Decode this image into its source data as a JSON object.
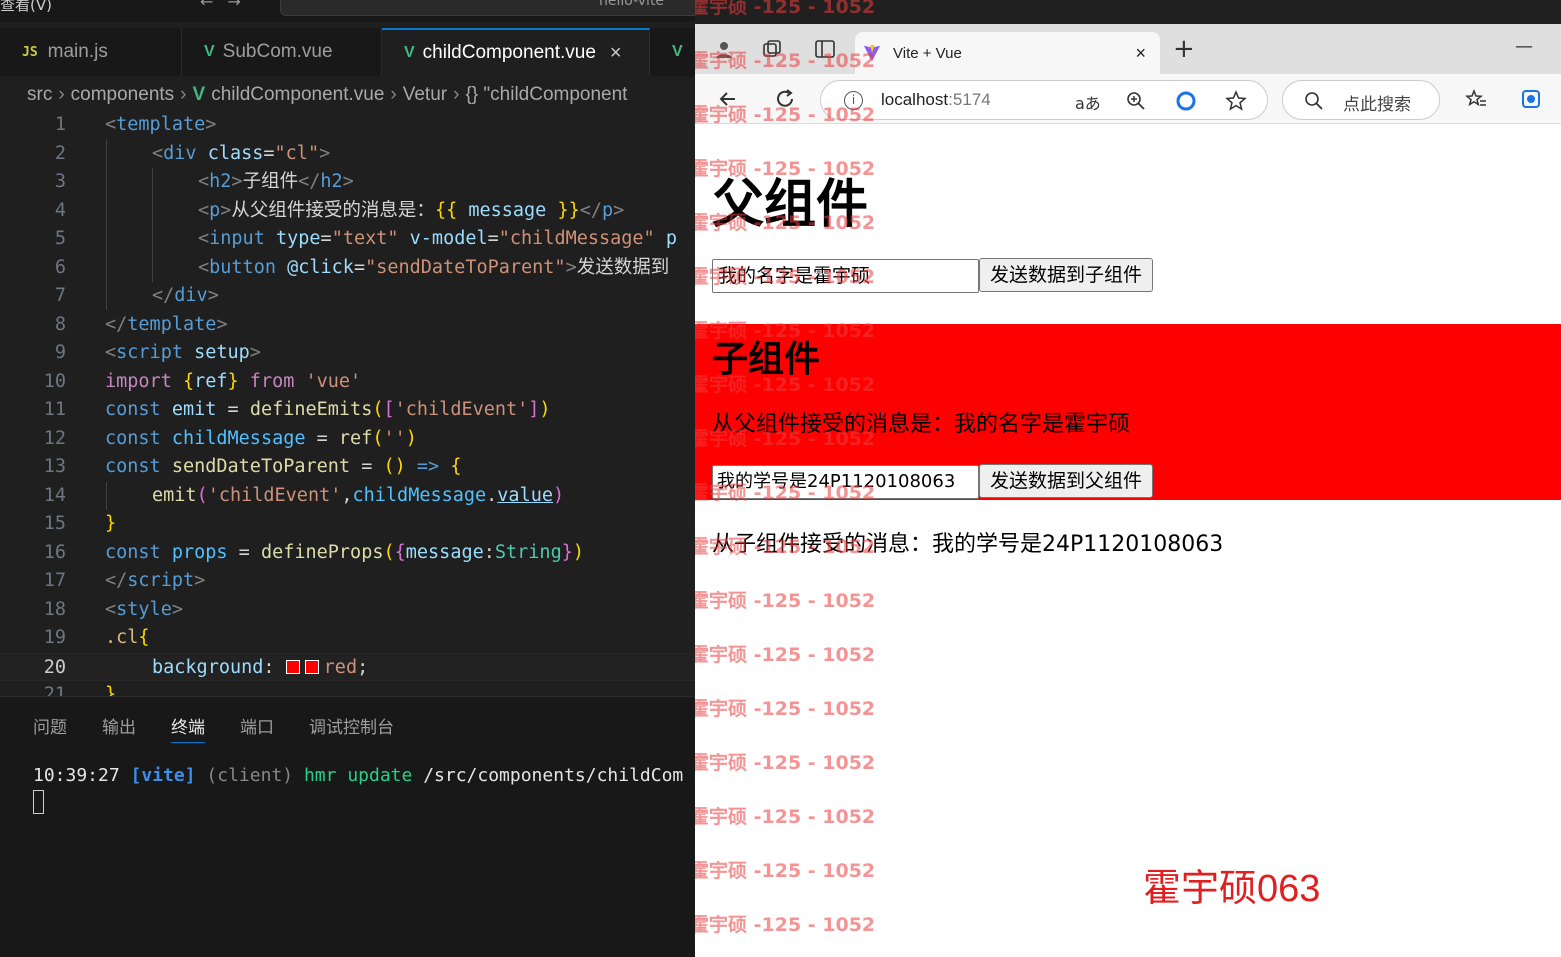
{
  "vscode": {
    "menu_label": "查看(V)",
    "menu_more": "···",
    "command_center_text": "hello-vite",
    "tabs": [
      {
        "badge": "JS",
        "label": "main.js"
      },
      {
        "badge": "V",
        "label": "SubCom.vue"
      },
      {
        "badge": "V",
        "label": "childComponent.vue",
        "close": "×"
      },
      {
        "badge": "V",
        "label": ""
      }
    ],
    "breadcrumb": [
      "src",
      "components",
      "childComponent.vue",
      "Vetur",
      "{} \"childComponent"
    ],
    "line_numbers": [
      "1",
      "2",
      "3",
      "4",
      "5",
      "6",
      "7",
      "8",
      "9",
      "10",
      "11",
      "12",
      "13",
      "14",
      "15",
      "16",
      "17",
      "18",
      "19",
      "20",
      "21"
    ],
    "code": {
      "l1": [
        "<",
        "template",
        ">"
      ],
      "l2": [
        "<",
        "div",
        " class",
        "=",
        "\"cl\"",
        ">"
      ],
      "l3": [
        "<",
        "h2",
        ">",
        "子组件",
        "</",
        "h2",
        ">"
      ],
      "l4": [
        "<",
        "p",
        ">",
        "从父组件接受的消息是：",
        "{{",
        " message ",
        "}}",
        "</",
        "p",
        ">"
      ],
      "l5": [
        "<",
        "input",
        " type",
        "=",
        "\"text\"",
        " v-model",
        "=",
        "\"childMessage\"",
        " p"
      ],
      "l6": [
        "<",
        "button",
        " @click",
        "=",
        "\"sendDateToParent\"",
        ">",
        "发送数据到"
      ],
      "l7": [
        "</",
        "div",
        ">"
      ],
      "l8": [
        "</",
        "template",
        ">"
      ],
      "l9": [
        "<",
        "script",
        " setup",
        ">"
      ],
      "l10": [
        "import",
        " ",
        "{",
        "ref",
        "}",
        " from ",
        "'vue'"
      ],
      "l11": [
        "const",
        " emit ",
        "= ",
        "defineEmits",
        "(",
        "[",
        "'childEvent'",
        "]",
        ")"
      ],
      "l12": [
        "const",
        " childMessage ",
        "= ",
        "ref",
        "(",
        "''",
        ")"
      ],
      "l13": [
        "const",
        " sendDateToParent ",
        "= ",
        "()",
        " => ",
        "{"
      ],
      "l14": [
        "emit",
        "(",
        "'childEvent'",
        ",",
        "childMessage",
        ".",
        "value",
        ")"
      ],
      "l15": [
        "}"
      ],
      "l16": [
        "const",
        " props ",
        "= ",
        "defineProps",
        "(",
        "{",
        "message",
        ":",
        "String",
        "}",
        ")"
      ],
      "l17": [
        "</",
        "script",
        ">"
      ],
      "l18": [
        "<",
        "style",
        ">"
      ],
      "l19": [
        ".cl",
        "{"
      ],
      "l20": [
        "background",
        ": ",
        "red",
        ";"
      ],
      "l21": [
        "}"
      ]
    },
    "panel_tabs": [
      "问题",
      "输出",
      "终端",
      "端口",
      "调试控制台"
    ],
    "terminal": {
      "time": "10:39:27",
      "tag": "[vite]",
      "client": "(client)",
      "hmr": "hmr update",
      "path": "/src/components/childCom"
    },
    "colors": {
      "accent": "#0078d4",
      "vue_green": "#41b883"
    }
  },
  "browser": {
    "tab_title": "Vite + Vue",
    "tab_close": "×",
    "new_tab": "+",
    "minimize": "—",
    "url_host": "localhost",
    "url_port": ":5174",
    "read_aloud": "aあ",
    "search_placeholder": "点此搜索",
    "page": {
      "parent_title": "父组件",
      "parent_input_value": "我的名字是霍宇硕",
      "parent_button": "发送数据到子组件",
      "child_title": "子组件",
      "child_message": "从父组件接受的消息是：我的名字是霍宇硕",
      "child_input_value": "我的学号是24P1120108063",
      "child_button": "发送数据到父组件",
      "from_child": "从子组件接受的消息：我的学号是24P1120108063",
      "signature": "霍宇硕063",
      "child_bg": "#ff0000"
    },
    "watermark": "霍宇硕 -125 - 1052"
  }
}
